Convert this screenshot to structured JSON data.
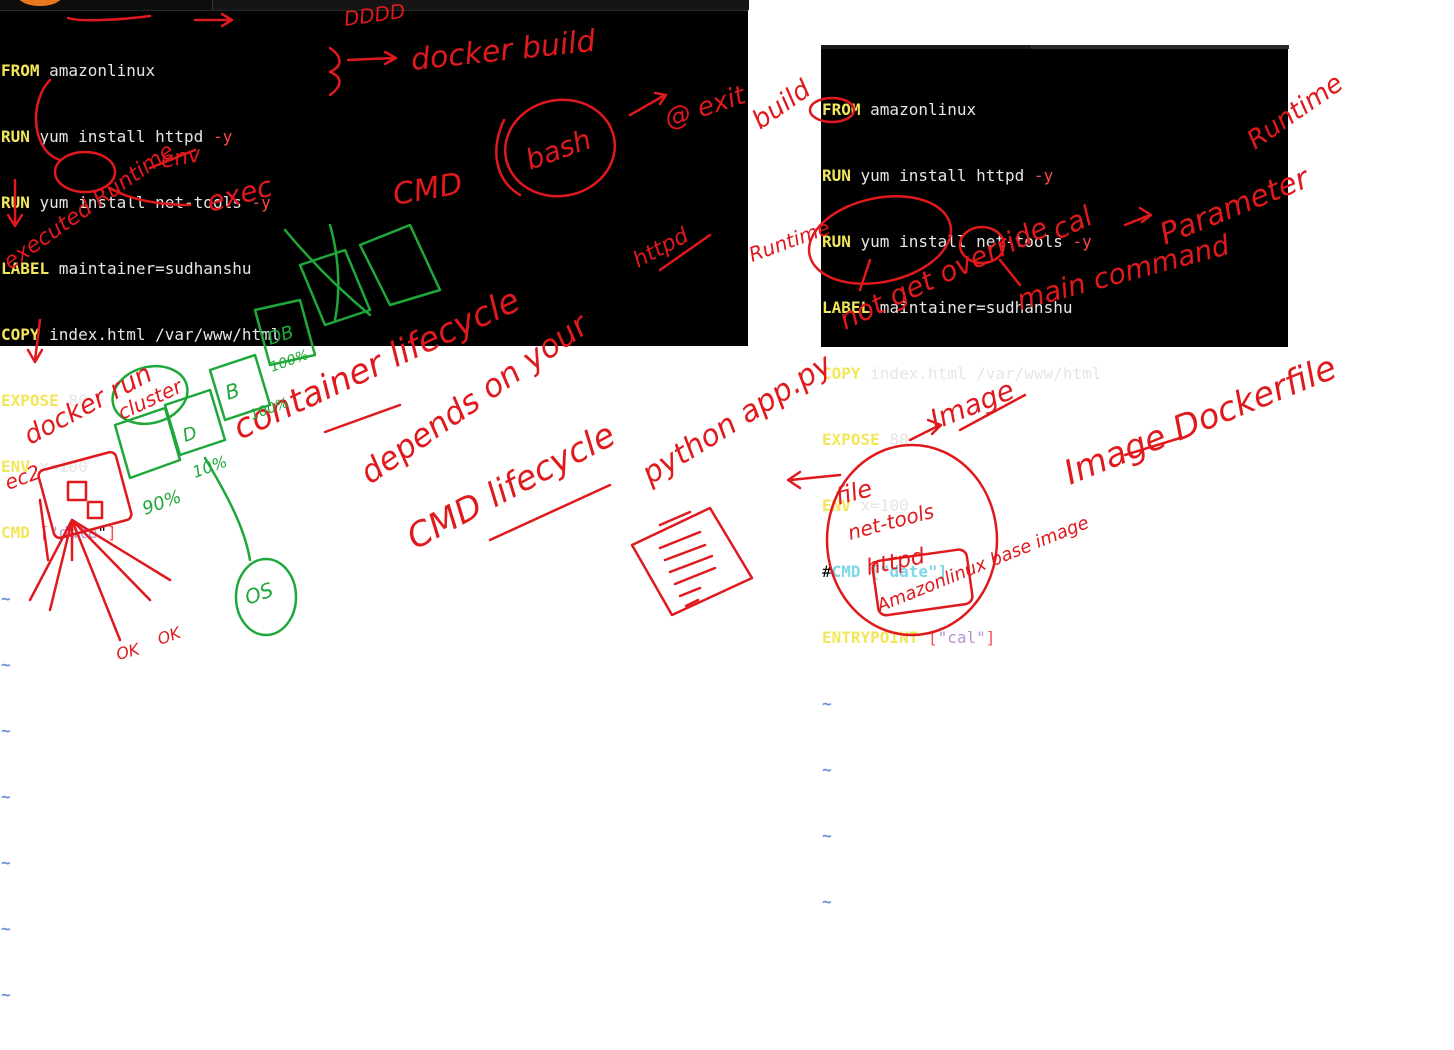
{
  "left_terminal": {
    "lines": [
      {
        "kw": "FROM",
        "text": " amazonlinux"
      },
      {
        "kw": "RUN",
        "text": " yum install httpd ",
        "flag": "-y"
      },
      {
        "kw": "RUN",
        "text": " yum install net-tools ",
        "flag": "-y"
      },
      {
        "kw": "LABEL",
        "text": " maintainer=sudhanshu"
      },
      {
        "kw": "COPY",
        "text": " index.html /var/www/html"
      },
      {
        "kw": "EXPOSE",
        "text": " 80"
      },
      {
        "kw": "ENV",
        "text": " x=100"
      },
      {
        "kw": "CMD",
        "pre": " [",
        "q1": "\"",
        "str": "date",
        "q2": "\"",
        "post": "]"
      }
    ],
    "tildes": [
      "~",
      "~",
      "~",
      "~",
      "~",
      "~",
      "~",
      "~"
    ]
  },
  "right_terminal": {
    "lines": [
      {
        "kw": "FROM",
        "text": " amazonlinux"
      },
      {
        "kw": "RUN",
        "text": " yum install httpd ",
        "flag": "-y"
      },
      {
        "kw": "RUN",
        "text": " yum install net-tools ",
        "flag": "-y"
      },
      {
        "kw": "LABEL",
        "text": " maintainer=sudhanshu"
      },
      {
        "kw": "COPY",
        "text": " index.html /var/www/html"
      },
      {
        "kw": "EXPOSE",
        "text": " 80"
      },
      {
        "kw": "ENV",
        "text": " x=100"
      }
    ],
    "comment_line": {
      "hash": "#",
      "text": "CMD [\"date\"]"
    },
    "entrypoint_line": {
      "kw": "ENTRYPOINT",
      "pre": " [",
      "q1": "\"",
      "str": "cal",
      "q2": "\"",
      "post": "]"
    },
    "tildes": [
      "~",
      "~",
      "~",
      "~"
    ]
  },
  "annotations": {
    "docker_build": "docker build",
    "dddd": "DDDD",
    "exit": "@ exit",
    "build": "build",
    "bash": "bash",
    "cmd": "CMD",
    "env": "env",
    "exec": "exec",
    "executed_runtime": "executed Runtime",
    "httpd": "httpd",
    "container_lifecycle": "container lifecycle",
    "depends_on_your": "depends on your",
    "cmd_lifecycle": "CMD lifecycle",
    "python_app": "python app.py",
    "docker_run": "docker run",
    "cluster": "cluster",
    "ec2": "ec2",
    "runtime_left": "Runtime",
    "cal": "cal",
    "parameter": "Parameter",
    "runtime_right": "Runtime",
    "main_command": "main command",
    "not_get_override": "not get override",
    "image": "Image",
    "image_dockerfile": "Image Dockerfile",
    "file": "file",
    "net_tools": "net-tools",
    "httpd_layer": "httpd",
    "amazonlinux_base": "Amazonlinux base image",
    "percent_90": "90%",
    "percent_10": "10%",
    "percent_100_a": "100%",
    "percent_100_b": "100%",
    "b_label": "B",
    "d_label": "D",
    "db_label": "DB",
    "ok": "OK",
    "ok_count": "OK",
    "os_label": "OS"
  },
  "colors": {
    "terminal_bg": "#000000",
    "keyword": "#f2e65a",
    "flag": "#ff4a4a",
    "string": "#b693d6",
    "comment": "#7fd6e6",
    "tilde": "#6a8ed8",
    "ink_red": "#e0191d",
    "ink_green": "#1fa83a"
  }
}
